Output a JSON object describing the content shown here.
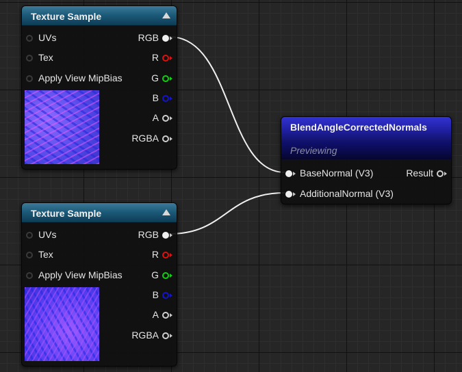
{
  "texture_nodes": [
    {
      "title": "Texture Sample",
      "inputs": [
        "UVs",
        "Tex",
        "Apply View MipBias"
      ],
      "outputs": [
        "RGB",
        "R",
        "G",
        "B",
        "A",
        "RGBA"
      ]
    },
    {
      "title": "Texture Sample",
      "inputs": [
        "UVs",
        "Tex",
        "Apply View MipBias"
      ],
      "outputs": [
        "RGB",
        "R",
        "G",
        "B",
        "A",
        "RGBA"
      ]
    }
  ],
  "blend_node": {
    "title": "BlendAngleCorrectedNormals",
    "previewing": "Previewing",
    "inputs": [
      "BaseNormal (V3)",
      "AdditionalNormal (V3)"
    ],
    "output": "Result"
  },
  "colors": {
    "texture_header": "#1c5b7a",
    "blend_header": "#1f1fa0",
    "pin_r": "#e01010",
    "pin_g": "#10d010",
    "pin_b": "#1414cc",
    "wire": "#f0f0f0"
  }
}
